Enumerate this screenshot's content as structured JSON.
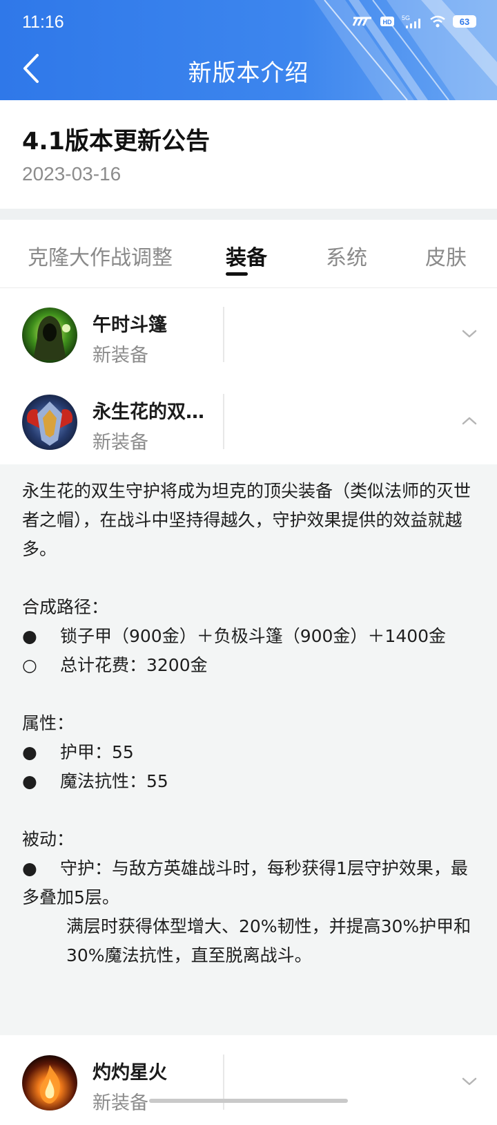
{
  "status_bar": {
    "time": "11:16",
    "battery": "63",
    "icons": [
      "speed-icon",
      "hd-icon",
      "signal-5g-icon",
      "wifi-icon",
      "battery-icon"
    ]
  },
  "header": {
    "title": "新版本介绍",
    "back_icon": "chevron-left-icon",
    "background_color": "#3a82ec"
  },
  "article": {
    "title": "4.1版本更新公告",
    "date": "2023-03-16"
  },
  "tabs": [
    {
      "label": "克隆大作战调整",
      "active": false
    },
    {
      "label": "装备",
      "active": true
    },
    {
      "label": "系统",
      "active": false
    },
    {
      "label": "皮肤",
      "active": false
    }
  ],
  "items": [
    {
      "name": "午时斗篷",
      "subtitle": "新装备",
      "expanded": false
    },
    {
      "name": "永生花的双生守护",
      "subtitle": "新装备",
      "expanded": true
    },
    {
      "name": "灼灼星火",
      "subtitle": "新装备",
      "expanded": false
    }
  ],
  "detail": {
    "intro": "永生花的双生守护将成为坦克的顶尖装备（类似法师的灭世者之帽），在战斗中坚持得越久，守护效果提供的效益就越多。",
    "recipe_heading": "合成路径：",
    "recipe_line": "锁子甲（900金）＋负极斗篷（900金）＋1400金",
    "total_cost": "总计花费：3200金",
    "stats_heading": "属性：",
    "stats": [
      "护甲：55",
      "魔法抗性：55"
    ],
    "passive_heading": "被动：",
    "passive_line1": "守护：与敌方英雄战斗时，每秒获得1层守护效果，最多叠加5层。",
    "passive_line2": "满层时获得体型增大、20%韧性，并提高30%护甲和30%魔法抗性，直至脱离战斗。"
  },
  "bullet_filled": "●",
  "bullet_hollow": "○"
}
